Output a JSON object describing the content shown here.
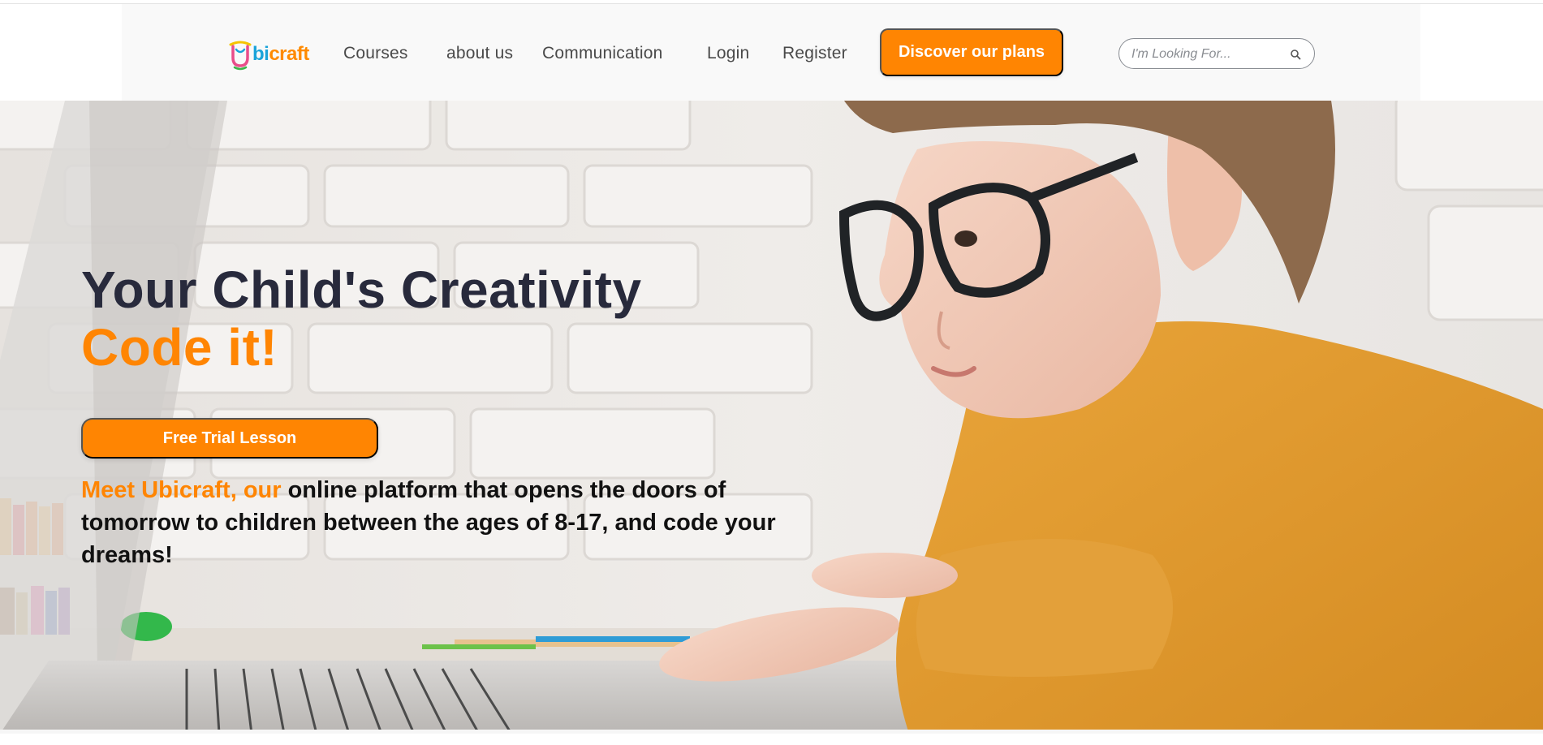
{
  "header": {
    "logo": {
      "b": "U",
      "i": "bi",
      "rest": "craft"
    },
    "nav": [
      {
        "label": "Courses"
      },
      {
        "label": "about us"
      },
      {
        "label": "Communication"
      },
      {
        "label": "Login"
      },
      {
        "label": "Register"
      }
    ],
    "cta_label": "Discover our plans",
    "search": {
      "placeholder": "I'm Looking For...",
      "value": "",
      "icon": "search-icon"
    }
  },
  "hero": {
    "title_line1": "Your Child's Creativity",
    "title_line2": "Code it!",
    "trial_button": "Free Trial Lesson",
    "desc_highlight": "Meet Ubicraft, our",
    "desc_rest": " online platform that opens the doors of tomorrow to children between the ages of 8-17, and code your dreams!"
  },
  "colors": {
    "accent": "#ff8502",
    "title_dark": "#282a3c",
    "nav_text": "#4a4a4a",
    "header_bg": "#f9f9f9"
  }
}
